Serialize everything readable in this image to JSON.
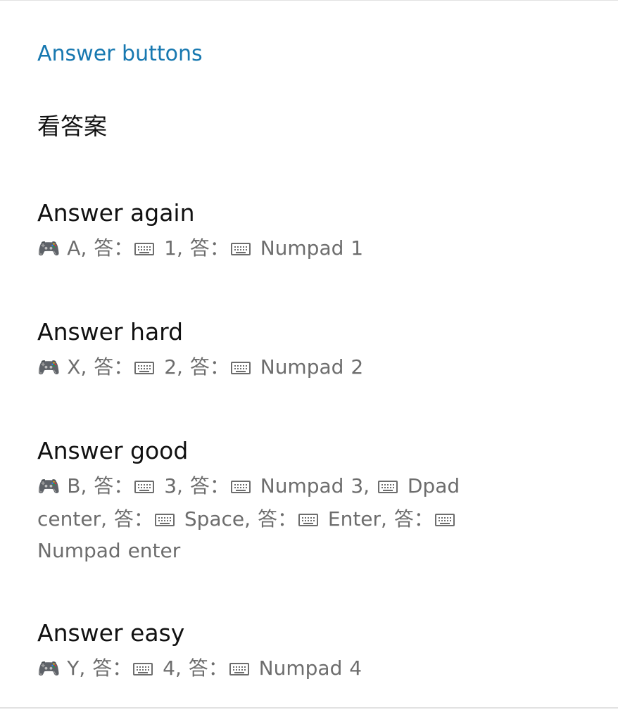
{
  "section": {
    "header": "Answer buttons",
    "category_title": "看答案"
  },
  "items": [
    {
      "title": "Answer again",
      "bindings": [
        {
          "type": "gamepad",
          "key": "A",
          "prefix": ""
        },
        {
          "type": "keyboard",
          "key": "1",
          "prefix": "答："
        },
        {
          "type": "keyboard",
          "key": "Numpad 1",
          "prefix": "答："
        }
      ]
    },
    {
      "title": "Answer hard",
      "bindings": [
        {
          "type": "gamepad",
          "key": "X",
          "prefix": ""
        },
        {
          "type": "keyboard",
          "key": "2",
          "prefix": "答："
        },
        {
          "type": "keyboard",
          "key": "Numpad 2",
          "prefix": "答："
        }
      ]
    },
    {
      "title": "Answer good",
      "bindings": [
        {
          "type": "gamepad",
          "key": "B",
          "prefix": ""
        },
        {
          "type": "keyboard",
          "key": "3",
          "prefix": "答："
        },
        {
          "type": "keyboard",
          "key": "Numpad 3",
          "prefix": "答："
        },
        {
          "type": "keyboard",
          "key": "Dpad center",
          "prefix": ""
        },
        {
          "type": "keyboard",
          "key": "Space",
          "prefix": "答："
        },
        {
          "type": "keyboard",
          "key": "Enter",
          "prefix": "答："
        },
        {
          "type": "keyboard",
          "key": "Numpad enter",
          "prefix": "答："
        }
      ]
    },
    {
      "title": "Answer easy",
      "bindings": [
        {
          "type": "gamepad",
          "key": "Y",
          "prefix": ""
        },
        {
          "type": "keyboard",
          "key": "4",
          "prefix": "答："
        },
        {
          "type": "keyboard",
          "key": "Numpad 4",
          "prefix": "答："
        }
      ]
    }
  ],
  "icons": {
    "gamepad": "gamepad-icon",
    "keyboard": "keyboard-icon"
  },
  "colors": {
    "accent": "#1778b0",
    "title": "#111111",
    "summary": "#6d6d6d",
    "divider": "#e2e2e2"
  }
}
